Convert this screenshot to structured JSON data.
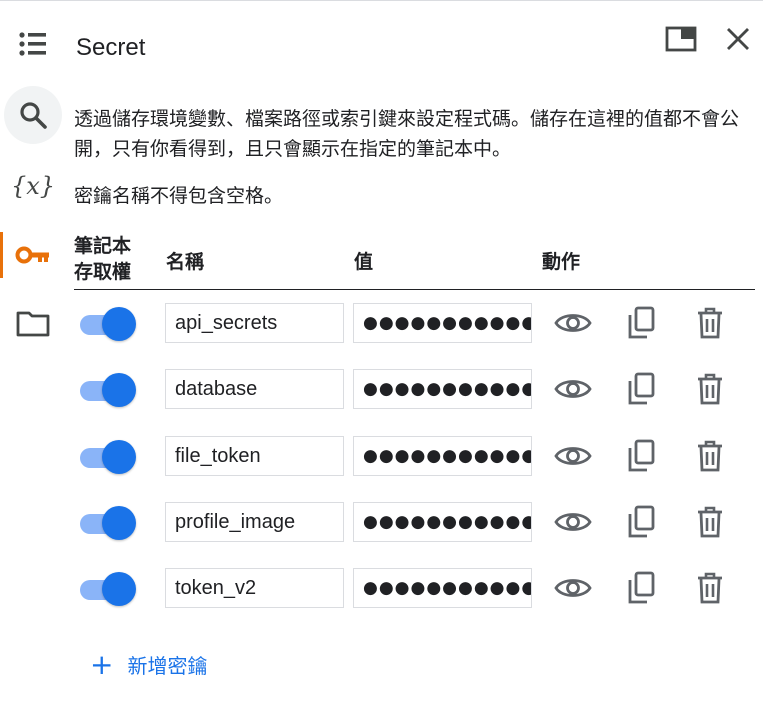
{
  "panel": {
    "title": "Secret",
    "description": "透過儲存環境變數、檔案路徑或索引鍵來設定程式碼。儲存在這裡的值都不會公開，只有你看得到，且只會顯示在指定的筆記本中。",
    "note": "密鑰名稱不得包含空格。"
  },
  "rail": {
    "items": [
      "toc-icon",
      "search-icon",
      "variables-icon",
      "key-icon",
      "folder-icon"
    ],
    "variables_glyph": "{x}",
    "active": "key-icon",
    "accent": "#e8710a"
  },
  "header_icons": [
    "open-in-tab-icon",
    "close-icon"
  ],
  "table": {
    "headers": {
      "access_line1": "筆記本",
      "access_line2": "存取權",
      "name": "名稱",
      "value": "值",
      "actions": "動作"
    },
    "rows": [
      {
        "enabled": true,
        "name": "api_secrets",
        "value_masked": "●●●●●●●●●●●●●●"
      },
      {
        "enabled": true,
        "name": "database",
        "value_masked": "●●●●●●●●●●●●●●"
      },
      {
        "enabled": true,
        "name": "file_token",
        "value_masked": "●●●●●●●●●●●●●●"
      },
      {
        "enabled": true,
        "name": "profile_image",
        "value_masked": "●●●●●●●●●●●●●●"
      },
      {
        "enabled": true,
        "name": "token_v2",
        "value_masked": "●●●●●●●●●●●●●●"
      }
    ],
    "row_actions": [
      "visibility-icon",
      "copy-icon",
      "delete-icon"
    ]
  },
  "add_button": {
    "plus": "+",
    "label": "新增密鑰"
  },
  "colors": {
    "toggle_on": "#1a73e8",
    "toggle_track": "#8ab4f8",
    "link": "#1a73e8",
    "icon": "#5f6368"
  }
}
